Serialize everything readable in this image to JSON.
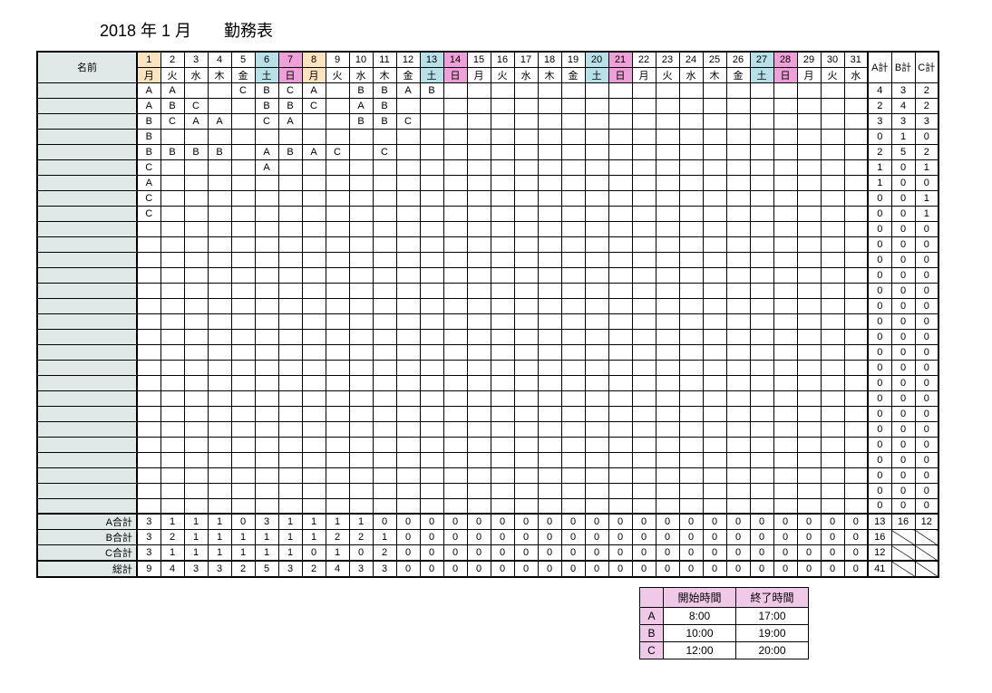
{
  "title": "2018 年 1 月　　勤務表",
  "header": {
    "name_label": "名前",
    "a_sum": "A計",
    "b_sum": "B計",
    "c_sum": "C計"
  },
  "days": {
    "numbers": [
      "1",
      "2",
      "3",
      "4",
      "5",
      "6",
      "7",
      "8",
      "9",
      "10",
      "11",
      "12",
      "13",
      "14",
      "15",
      "16",
      "17",
      "18",
      "19",
      "20",
      "21",
      "22",
      "23",
      "24",
      "25",
      "26",
      "27",
      "28",
      "29",
      "30",
      "31"
    ],
    "weekdays": [
      "月",
      "火",
      "水",
      "木",
      "金",
      "土",
      "日",
      "月",
      "火",
      "水",
      "木",
      "金",
      "土",
      "日",
      "月",
      "火",
      "水",
      "木",
      "金",
      "土",
      "日",
      "月",
      "火",
      "水",
      "木",
      "金",
      "土",
      "日",
      "月",
      "火",
      "水"
    ],
    "classes": [
      "holiday1",
      "",
      "",
      "",
      "",
      "sat",
      "sun",
      "holiday1",
      "",
      "",
      "",
      "",
      "sat",
      "sun",
      "",
      "",
      "",
      "",
      "",
      "sat",
      "sun",
      "",
      "",
      "",
      "",
      "",
      "sat",
      "sun",
      "",
      "",
      ""
    ]
  },
  "rows": [
    {
      "cells": [
        "A",
        "A",
        "",
        "",
        "C",
        "B",
        "C",
        "A",
        "",
        "B",
        "B",
        "A",
        "B",
        "",
        "",
        "",
        "",
        "",
        "",
        "",
        "",
        "",
        "",
        "",
        "",
        "",
        "",
        "",
        "",
        "",
        ""
      ],
      "a": "4",
      "b": "3",
      "c": "2"
    },
    {
      "cells": [
        "A",
        "B",
        "C",
        "",
        "",
        "B",
        "B",
        "C",
        "",
        "A",
        "B",
        "",
        "",
        "",
        "",
        "",
        "",
        "",
        "",
        "",
        "",
        "",
        "",
        "",
        "",
        "",
        "",
        "",
        "",
        "",
        ""
      ],
      "a": "2",
      "b": "4",
      "c": "2"
    },
    {
      "cells": [
        "B",
        "C",
        "A",
        "A",
        "",
        "C",
        "A",
        "",
        "",
        "B",
        "B",
        "C",
        "",
        "",
        "",
        "",
        "",
        "",
        "",
        "",
        "",
        "",
        "",
        "",
        "",
        "",
        "",
        "",
        "",
        "",
        ""
      ],
      "a": "3",
      "b": "3",
      "c": "3"
    },
    {
      "cells": [
        "B",
        "",
        "",
        "",
        "",
        "",
        "",
        "",
        "",
        "",
        "",
        "",
        "",
        "",
        "",
        "",
        "",
        "",
        "",
        "",
        "",
        "",
        "",
        "",
        "",
        "",
        "",
        "",
        "",
        "",
        ""
      ],
      "a": "0",
      "b": "1",
      "c": "0"
    },
    {
      "cells": [
        "B",
        "B",
        "B",
        "B",
        "",
        "A",
        "B",
        "A",
        "C",
        "",
        "C",
        "",
        "",
        "",
        "",
        "",
        "",
        "",
        "",
        "",
        "",
        "",
        "",
        "",
        "",
        "",
        "",
        "",
        "",
        "",
        ""
      ],
      "a": "2",
      "b": "5",
      "c": "2"
    },
    {
      "cells": [
        "C",
        "",
        "",
        "",
        "",
        "A",
        "",
        "",
        "",
        "",
        "",
        "",
        "",
        "",
        "",
        "",
        "",
        "",
        "",
        "",
        "",
        "",
        "",
        "",
        "",
        "",
        "",
        "",
        "",
        "",
        ""
      ],
      "a": "1",
      "b": "0",
      "c": "1"
    },
    {
      "cells": [
        "A",
        "",
        "",
        "",
        "",
        "",
        "",
        "",
        "",
        "",
        "",
        "",
        "",
        "",
        "",
        "",
        "",
        "",
        "",
        "",
        "",
        "",
        "",
        "",
        "",
        "",
        "",
        "",
        "",
        "",
        ""
      ],
      "a": "1",
      "b": "0",
      "c": "0"
    },
    {
      "cells": [
        "C",
        "",
        "",
        "",
        "",
        "",
        "",
        "",
        "",
        "",
        "",
        "",
        "",
        "",
        "",
        "",
        "",
        "",
        "",
        "",
        "",
        "",
        "",
        "",
        "",
        "",
        "",
        "",
        "",
        "",
        ""
      ],
      "a": "0",
      "b": "0",
      "c": "1"
    },
    {
      "cells": [
        "C",
        "",
        "",
        "",
        "",
        "",
        "",
        "",
        "",
        "",
        "",
        "",
        "",
        "",
        "",
        "",
        "",
        "",
        "",
        "",
        "",
        "",
        "",
        "",
        "",
        "",
        "",
        "",
        "",
        "",
        ""
      ],
      "a": "0",
      "b": "0",
      "c": "1"
    },
    {
      "cells": [
        "",
        "",
        "",
        "",
        "",
        "",
        "",
        "",
        "",
        "",
        "",
        "",
        "",
        "",
        "",
        "",
        "",
        "",
        "",
        "",
        "",
        "",
        "",
        "",
        "",
        "",
        "",
        "",
        "",
        "",
        ""
      ],
      "a": "0",
      "b": "0",
      "c": "0"
    },
    {
      "cells": [
        "",
        "",
        "",
        "",
        "",
        "",
        "",
        "",
        "",
        "",
        "",
        "",
        "",
        "",
        "",
        "",
        "",
        "",
        "",
        "",
        "",
        "",
        "",
        "",
        "",
        "",
        "",
        "",
        "",
        "",
        ""
      ],
      "a": "0",
      "b": "0",
      "c": "0"
    },
    {
      "cells": [
        "",
        "",
        "",
        "",
        "",
        "",
        "",
        "",
        "",
        "",
        "",
        "",
        "",
        "",
        "",
        "",
        "",
        "",
        "",
        "",
        "",
        "",
        "",
        "",
        "",
        "",
        "",
        "",
        "",
        "",
        ""
      ],
      "a": "0",
      "b": "0",
      "c": "0"
    },
    {
      "cells": [
        "",
        "",
        "",
        "",
        "",
        "",
        "",
        "",
        "",
        "",
        "",
        "",
        "",
        "",
        "",
        "",
        "",
        "",
        "",
        "",
        "",
        "",
        "",
        "",
        "",
        "",
        "",
        "",
        "",
        "",
        ""
      ],
      "a": "0",
      "b": "0",
      "c": "0"
    },
    {
      "cells": [
        "",
        "",
        "",
        "",
        "",
        "",
        "",
        "",
        "",
        "",
        "",
        "",
        "",
        "",
        "",
        "",
        "",
        "",
        "",
        "",
        "",
        "",
        "",
        "",
        "",
        "",
        "",
        "",
        "",
        "",
        ""
      ],
      "a": "0",
      "b": "0",
      "c": "0"
    },
    {
      "cells": [
        "",
        "",
        "",
        "",
        "",
        "",
        "",
        "",
        "",
        "",
        "",
        "",
        "",
        "",
        "",
        "",
        "",
        "",
        "",
        "",
        "",
        "",
        "",
        "",
        "",
        "",
        "",
        "",
        "",
        "",
        ""
      ],
      "a": "0",
      "b": "0",
      "c": "0"
    },
    {
      "cells": [
        "",
        "",
        "",
        "",
        "",
        "",
        "",
        "",
        "",
        "",
        "",
        "",
        "",
        "",
        "",
        "",
        "",
        "",
        "",
        "",
        "",
        "",
        "",
        "",
        "",
        "",
        "",
        "",
        "",
        "",
        ""
      ],
      "a": "0",
      "b": "0",
      "c": "0"
    },
    {
      "cells": [
        "",
        "",
        "",
        "",
        "",
        "",
        "",
        "",
        "",
        "",
        "",
        "",
        "",
        "",
        "",
        "",
        "",
        "",
        "",
        "",
        "",
        "",
        "",
        "",
        "",
        "",
        "",
        "",
        "",
        "",
        ""
      ],
      "a": "0",
      "b": "0",
      "c": "0"
    },
    {
      "cells": [
        "",
        "",
        "",
        "",
        "",
        "",
        "",
        "",
        "",
        "",
        "",
        "",
        "",
        "",
        "",
        "",
        "",
        "",
        "",
        "",
        "",
        "",
        "",
        "",
        "",
        "",
        "",
        "",
        "",
        "",
        ""
      ],
      "a": "0",
      "b": "0",
      "c": "0"
    },
    {
      "cells": [
        "",
        "",
        "",
        "",
        "",
        "",
        "",
        "",
        "",
        "",
        "",
        "",
        "",
        "",
        "",
        "",
        "",
        "",
        "",
        "",
        "",
        "",
        "",
        "",
        "",
        "",
        "",
        "",
        "",
        "",
        ""
      ],
      "a": "0",
      "b": "0",
      "c": "0"
    },
    {
      "cells": [
        "",
        "",
        "",
        "",
        "",
        "",
        "",
        "",
        "",
        "",
        "",
        "",
        "",
        "",
        "",
        "",
        "",
        "",
        "",
        "",
        "",
        "",
        "",
        "",
        "",
        "",
        "",
        "",
        "",
        "",
        ""
      ],
      "a": "0",
      "b": "0",
      "c": "0"
    },
    {
      "cells": [
        "",
        "",
        "",
        "",
        "",
        "",
        "",
        "",
        "",
        "",
        "",
        "",
        "",
        "",
        "",
        "",
        "",
        "",
        "",
        "",
        "",
        "",
        "",
        "",
        "",
        "",
        "",
        "",
        "",
        "",
        ""
      ],
      "a": "0",
      "b": "0",
      "c": "0"
    },
    {
      "cells": [
        "",
        "",
        "",
        "",
        "",
        "",
        "",
        "",
        "",
        "",
        "",
        "",
        "",
        "",
        "",
        "",
        "",
        "",
        "",
        "",
        "",
        "",
        "",
        "",
        "",
        "",
        "",
        "",
        "",
        "",
        ""
      ],
      "a": "0",
      "b": "0",
      "c": "0"
    },
    {
      "cells": [
        "",
        "",
        "",
        "",
        "",
        "",
        "",
        "",
        "",
        "",
        "",
        "",
        "",
        "",
        "",
        "",
        "",
        "",
        "",
        "",
        "",
        "",
        "",
        "",
        "",
        "",
        "",
        "",
        "",
        "",
        ""
      ],
      "a": "0",
      "b": "0",
      "c": "0"
    },
    {
      "cells": [
        "",
        "",
        "",
        "",
        "",
        "",
        "",
        "",
        "",
        "",
        "",
        "",
        "",
        "",
        "",
        "",
        "",
        "",
        "",
        "",
        "",
        "",
        "",
        "",
        "",
        "",
        "",
        "",
        "",
        "",
        ""
      ],
      "a": "0",
      "b": "0",
      "c": "0"
    },
    {
      "cells": [
        "",
        "",
        "",
        "",
        "",
        "",
        "",
        "",
        "",
        "",
        "",
        "",
        "",
        "",
        "",
        "",
        "",
        "",
        "",
        "",
        "",
        "",
        "",
        "",
        "",
        "",
        "",
        "",
        "",
        "",
        ""
      ],
      "a": "0",
      "b": "0",
      "c": "0"
    },
    {
      "cells": [
        "",
        "",
        "",
        "",
        "",
        "",
        "",
        "",
        "",
        "",
        "",
        "",
        "",
        "",
        "",
        "",
        "",
        "",
        "",
        "",
        "",
        "",
        "",
        "",
        "",
        "",
        "",
        "",
        "",
        "",
        ""
      ],
      "a": "0",
      "b": "0",
      "c": "0"
    },
    {
      "cells": [
        "",
        "",
        "",
        "",
        "",
        "",
        "",
        "",
        "",
        "",
        "",
        "",
        "",
        "",
        "",
        "",
        "",
        "",
        "",
        "",
        "",
        "",
        "",
        "",
        "",
        "",
        "",
        "",
        "",
        "",
        ""
      ],
      "a": "0",
      "b": "0",
      "c": "0"
    },
    {
      "cells": [
        "",
        "",
        "",
        "",
        "",
        "",
        "",
        "",
        "",
        "",
        "",
        "",
        "",
        "",
        "",
        "",
        "",
        "",
        "",
        "",
        "",
        "",
        "",
        "",
        "",
        "",
        "",
        "",
        "",
        "",
        ""
      ],
      "a": "0",
      "b": "0",
      "c": "0"
    }
  ],
  "totals": {
    "a_label": "A合計",
    "b_label": "B合計",
    "c_label": "C合計",
    "g_label": "総計",
    "a": [
      "3",
      "1",
      "1",
      "1",
      "0",
      "3",
      "1",
      "1",
      "1",
      "1",
      "0",
      "0",
      "0",
      "0",
      "0",
      "0",
      "0",
      "0",
      "0",
      "0",
      "0",
      "0",
      "0",
      "0",
      "0",
      "0",
      "0",
      "0",
      "0",
      "0",
      "0"
    ],
    "b": [
      "3",
      "2",
      "1",
      "1",
      "1",
      "1",
      "1",
      "1",
      "2",
      "2",
      "1",
      "0",
      "0",
      "0",
      "0",
      "0",
      "0",
      "0",
      "0",
      "0",
      "0",
      "0",
      "0",
      "0",
      "0",
      "0",
      "0",
      "0",
      "0",
      "0",
      "0"
    ],
    "c": [
      "3",
      "1",
      "1",
      "1",
      "1",
      "1",
      "1",
      "0",
      "1",
      "0",
      "2",
      "0",
      "0",
      "0",
      "0",
      "0",
      "0",
      "0",
      "0",
      "0",
      "0",
      "0",
      "0",
      "0",
      "0",
      "0",
      "0",
      "0",
      "0",
      "0",
      "0"
    ],
    "g": [
      "9",
      "4",
      "3",
      "3",
      "2",
      "5",
      "3",
      "2",
      "4",
      "3",
      "3",
      "0",
      "0",
      "0",
      "0",
      "0",
      "0",
      "0",
      "0",
      "0",
      "0",
      "0",
      "0",
      "0",
      "0",
      "0",
      "0",
      "0",
      "0",
      "0",
      "0"
    ],
    "a_sum": "13",
    "b_sum": "16",
    "c_sum": "12",
    "g_sum": "41"
  },
  "legend": {
    "h1": "開始時間",
    "h2": "終了時間",
    "rows": [
      {
        "k": "A",
        "s": "8:00",
        "e": "17:00"
      },
      {
        "k": "B",
        "s": "10:00",
        "e": "19:00"
      },
      {
        "k": "C",
        "s": "12:00",
        "e": "20:00"
      }
    ]
  }
}
